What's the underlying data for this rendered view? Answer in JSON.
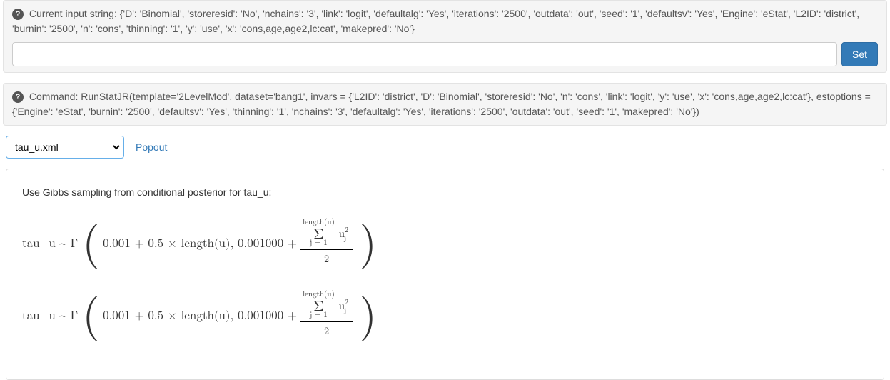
{
  "input_panel": {
    "label": "Current input string:",
    "value": "{'D': 'Binomial', 'storeresid': 'No', 'nchains': '3', 'link': 'logit', 'defaultalg': 'Yes', 'iterations': '2500', 'outdata': 'out', 'seed': '1', 'defaultsv': 'Yes', 'Engine': 'eStat', 'L2ID': 'district', 'burnin': '2500', 'n': 'cons', 'thinning': '1', 'y': 'use', 'x': 'cons,age,age2,lc:cat', 'makepred': 'No'}",
    "set_button": "Set"
  },
  "command_panel": {
    "label": "Command:",
    "value": "RunStatJR(template='2LevelMod', dataset='bang1', invars = {'L2ID': 'district', 'D': 'Binomial', 'storeresid': 'No', 'n': 'cons', 'link': 'logit', 'y': 'use', 'x': 'cons,age,age2,lc:cat'}, estoptions = {'Engine': 'eStat', 'burnin': '2500', 'defaultsv': 'Yes', 'thinning': '1', 'nchains': '3', 'defaultalg': 'Yes', 'iterations': '2500', 'outdata': 'out', 'seed': '1', 'makepred': 'No'})"
  },
  "output": {
    "selected": "tau_u.xml",
    "popout": "Popout",
    "heading": "Use Gibbs sampling from conditional posterior for tau_u:",
    "formula": {
      "lhs": "tau_u ~ Γ",
      "arg1": "0.001 + 0.5 × length(u), 0.001000 +",
      "sum_top": "length(u)",
      "sum_sym": "Σ",
      "sum_bot": "j = 1",
      "term_u": "u",
      "term_sub": "j",
      "term_sup": "2",
      "denom": "2"
    }
  }
}
